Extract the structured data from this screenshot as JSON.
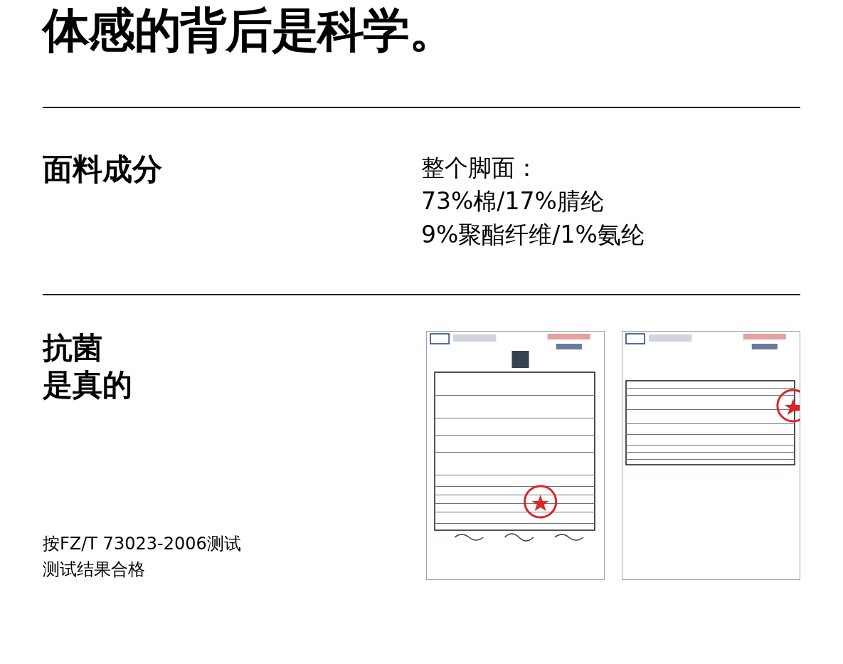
{
  "title": "体感的背后是科学。",
  "fabric": {
    "heading": "面料成分",
    "lines": [
      "整个脚面：",
      "73%棉/17%腈纶",
      "9%聚酯纤维/1%氨纶"
    ]
  },
  "antibacterial": {
    "heading_lines": [
      "抗菌",
      "是真的"
    ],
    "note_lines": [
      "按FZ/T 73023-2006测试",
      "测试结果合格"
    ],
    "reports": [
      {
        "kind": "picture"
      },
      {
        "kind": "picture"
      }
    ]
  }
}
